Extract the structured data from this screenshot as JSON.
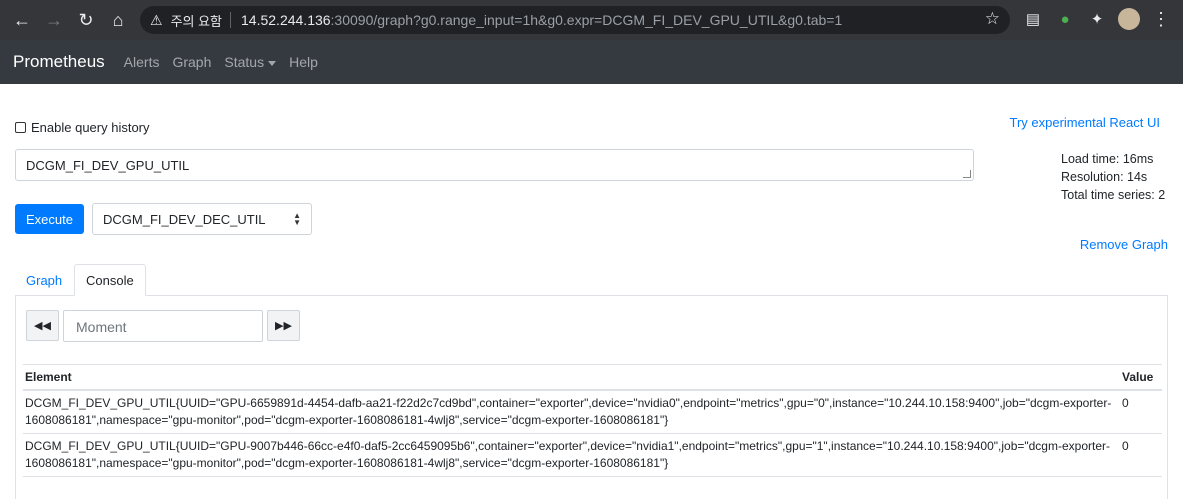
{
  "browser": {
    "warning_text": "주의 요함",
    "url_host": "14.52.244.136",
    "url_path": ":30090/graph?g0.range_input=1h&g0.expr=DCGM_FI_DEV_GPU_UTIL&g0.tab=1"
  },
  "navbar": {
    "brand": "Prometheus",
    "links": [
      "Alerts",
      "Graph",
      "Status",
      "Help"
    ]
  },
  "query": {
    "history_label": "Enable query history",
    "react_link": "Try experimental React UI",
    "expression": "DCGM_FI_DEV_GPU_UTIL",
    "execute_label": "Execute",
    "metric_selected": "DCGM_FI_DEV_DEC_UTIL",
    "remove_label": "Remove Graph"
  },
  "stats": {
    "load_time": "Load time: 16ms",
    "resolution": "Resolution: 14s",
    "total_series": "Total time series: 2"
  },
  "tabs": {
    "graph": "Graph",
    "console": "Console"
  },
  "console": {
    "moment_placeholder": "Moment",
    "col_element": "Element",
    "col_value": "Value",
    "rows": [
      {
        "element": "DCGM_FI_DEV_GPU_UTIL{UUID=\"GPU-6659891d-4454-dafb-aa21-f22d2c7cd9bd\",container=\"exporter\",device=\"nvidia0\",endpoint=\"metrics\",gpu=\"0\",instance=\"10.244.10.158:9400\",job=\"dcgm-exporter-1608086181\",namespace=\"gpu-monitor\",pod=\"dcgm-exporter-1608086181-4wlj8\",service=\"dcgm-exporter-1608086181\"}",
        "value": "0"
      },
      {
        "element": "DCGM_FI_DEV_GPU_UTIL{UUID=\"GPU-9007b446-66cc-e4f0-daf5-2cc6459095b6\",container=\"exporter\",device=\"nvidia1\",endpoint=\"metrics\",gpu=\"1\",instance=\"10.244.10.158:9400\",job=\"dcgm-exporter-1608086181\",namespace=\"gpu-monitor\",pod=\"dcgm-exporter-1608086181-4wlj8\",service=\"dcgm-exporter-1608086181\"}",
        "value": "0"
      }
    ]
  }
}
